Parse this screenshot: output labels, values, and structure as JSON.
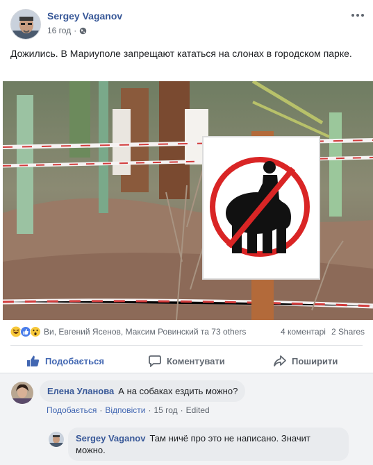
{
  "post": {
    "author": "Sergey Vaganov",
    "time": "16 год",
    "text": "Дожились. В Мариуполе запрещают кататься на слонах в городском парке."
  },
  "reactions": {
    "names": "Ви, Евгений Ясенов, Максим Ровинский та 73 others",
    "comments": "4 коментарі",
    "shares": "2 Shares"
  },
  "actions": {
    "like": "Подобається",
    "comment": "Коментувати",
    "share": "Поширити"
  },
  "comments": [
    {
      "author": "Елена Уланова",
      "text": "А на собаках ездить можно?",
      "like": "Подобається",
      "reply": "Відповісти",
      "time": "15 год",
      "edited": "Edited"
    },
    {
      "author": "Sergey Vaganov",
      "text_line1": "Там ничё про это не написано. Значит",
      "text_line2": "можно."
    }
  ],
  "colors": {
    "link_blue": "#385898",
    "like_blue": "#4267b2",
    "meta_gray": "#606770",
    "bubble_bg": "#e9ebee"
  }
}
